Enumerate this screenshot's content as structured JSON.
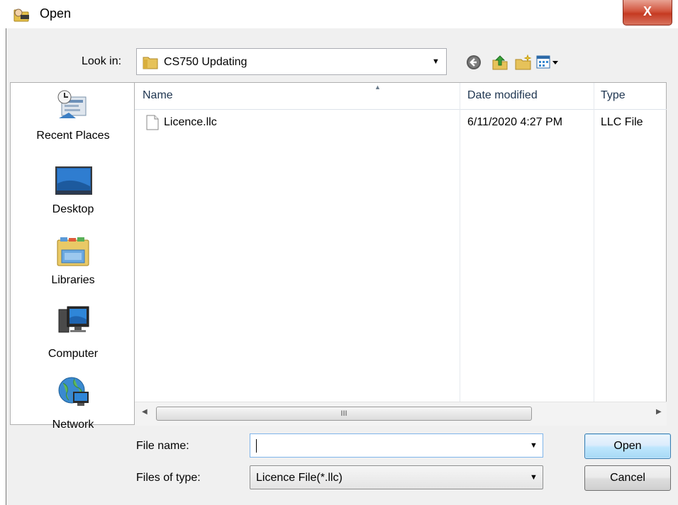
{
  "dialog": {
    "title": "Open",
    "close_label": "X"
  },
  "look_in": {
    "label": "Look in:",
    "value": "CS750 Updating"
  },
  "places": [
    {
      "id": "recent",
      "label": "Recent Places"
    },
    {
      "id": "desktop",
      "label": "Desktop"
    },
    {
      "id": "libraries",
      "label": "Libraries"
    },
    {
      "id": "computer",
      "label": "Computer"
    },
    {
      "id": "network",
      "label": "Network"
    }
  ],
  "file_list": {
    "columns": [
      "Name",
      "Date modified",
      "Type"
    ],
    "rows": [
      {
        "name": "Licence.llc",
        "date": "6/11/2020 4:27 PM",
        "type": "LLC File"
      }
    ],
    "scroll_grip": "III"
  },
  "file_name": {
    "label": "File name:",
    "value": ""
  },
  "file_type": {
    "label": "Files of type:",
    "value": "Licence File(*.llc)"
  },
  "buttons": {
    "open": "Open",
    "cancel": "Cancel"
  },
  "colors": {
    "close": "#c53a22",
    "accent": "#3c7fb1",
    "header_text": "#1e3550"
  }
}
